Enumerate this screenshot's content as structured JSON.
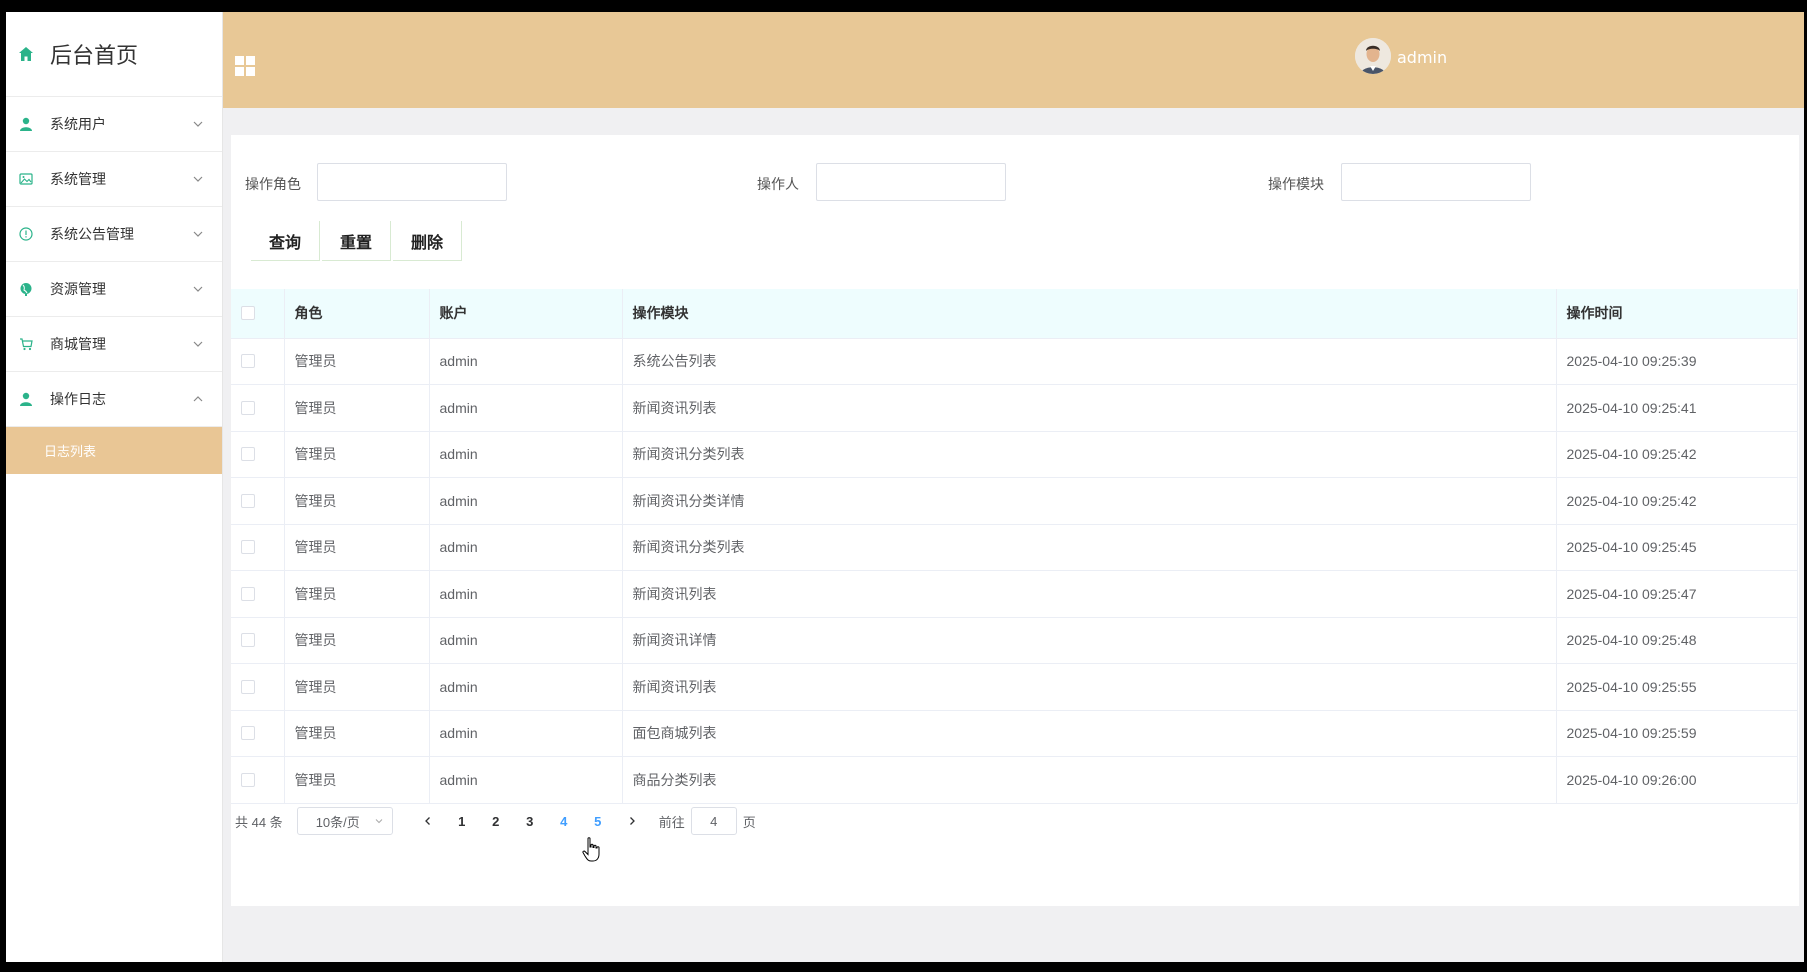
{
  "sidebar": {
    "brand_title": "后台首页",
    "items": [
      {
        "label": "系统用户",
        "icon": "user-icon",
        "expanded": false
      },
      {
        "label": "系统管理",
        "icon": "image-icon",
        "expanded": false
      },
      {
        "label": "系统公告管理",
        "icon": "alert-circle-icon",
        "expanded": false
      },
      {
        "label": "资源管理",
        "icon": "globe-icon",
        "expanded": false
      },
      {
        "label": "商城管理",
        "icon": "cart-icon",
        "expanded": false
      },
      {
        "label": "操作日志",
        "icon": "user-icon",
        "expanded": true
      }
    ],
    "sub_active": "日志列表"
  },
  "header": {
    "user_name": "admin"
  },
  "filters": {
    "role_label": "操作角色",
    "operator_label": "操作人",
    "module_label": "操作模块",
    "role_value": "",
    "operator_value": "",
    "module_value": ""
  },
  "buttons": {
    "query": "查询",
    "reset": "重置",
    "delete": "删除"
  },
  "table": {
    "headers": [
      "角色",
      "账户",
      "操作模块",
      "操作时间"
    ],
    "rows": [
      [
        "管理员",
        "admin",
        "系统公告列表",
        "2025-04-10 09:25:39"
      ],
      [
        "管理员",
        "admin",
        "新闻资讯列表",
        "2025-04-10 09:25:41"
      ],
      [
        "管理员",
        "admin",
        "新闻资讯分类列表",
        "2025-04-10 09:25:42"
      ],
      [
        "管理员",
        "admin",
        "新闻资讯分类详情",
        "2025-04-10 09:25:42"
      ],
      [
        "管理员",
        "admin",
        "新闻资讯分类列表",
        "2025-04-10 09:25:45"
      ],
      [
        "管理员",
        "admin",
        "新闻资讯列表",
        "2025-04-10 09:25:47"
      ],
      [
        "管理员",
        "admin",
        "新闻资讯详情",
        "2025-04-10 09:25:48"
      ],
      [
        "管理员",
        "admin",
        "新闻资讯列表",
        "2025-04-10 09:25:55"
      ],
      [
        "管理员",
        "admin",
        "面包商城列表",
        "2025-04-10 09:25:59"
      ],
      [
        "管理员",
        "admin",
        "商品分类列表",
        "2025-04-10 09:26:00"
      ]
    ]
  },
  "pagination": {
    "total": "共 44 条",
    "page_size": "10条/页",
    "pages": [
      "1",
      "2",
      "3",
      "4",
      "5"
    ],
    "current": "4",
    "goto_label": "前往",
    "goto_value": "4",
    "page_suffix": "页"
  },
  "colors": {
    "accent": "#e8c896",
    "active_page": "#409eff",
    "header_bg": "#eefdfe"
  }
}
